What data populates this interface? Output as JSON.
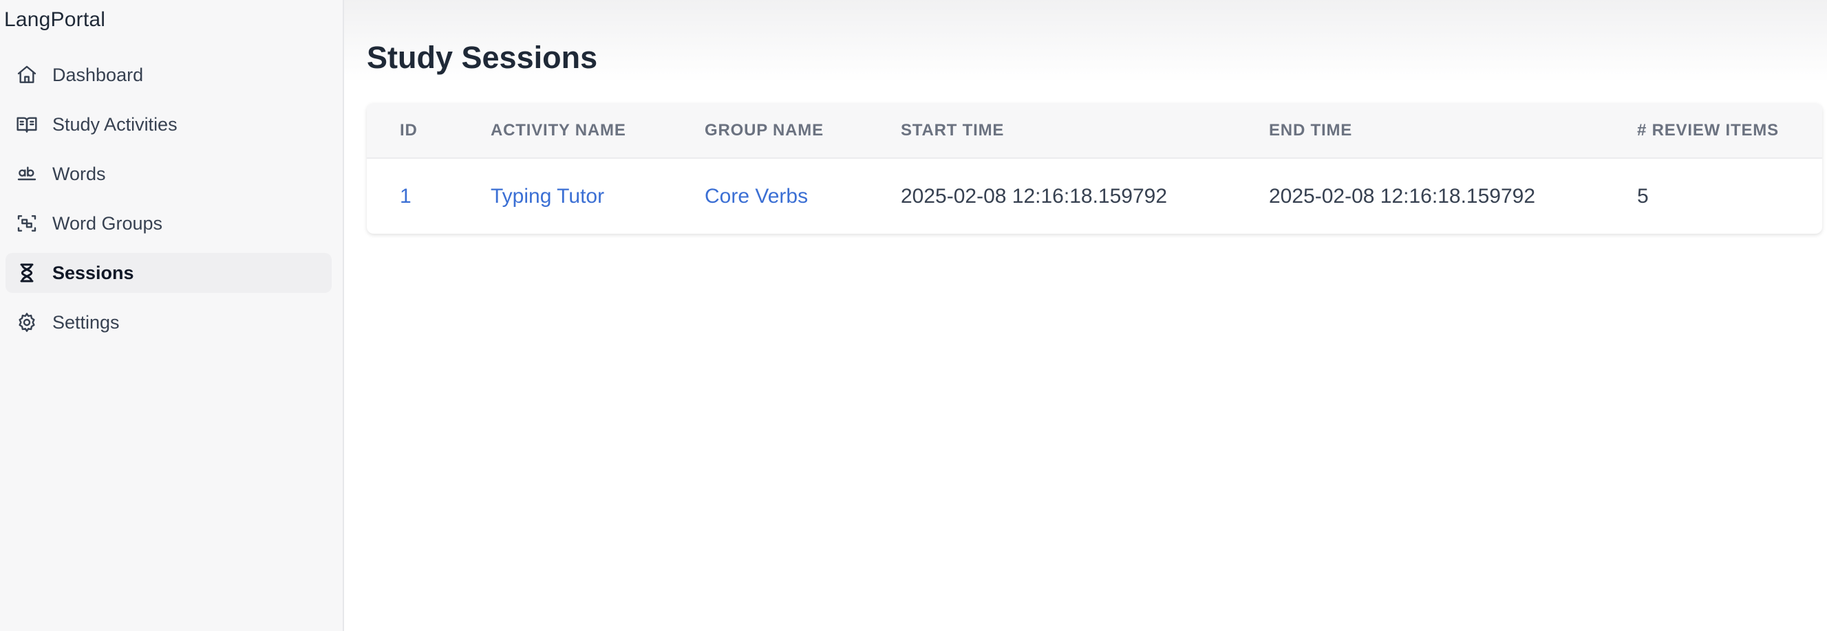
{
  "app": {
    "brand": "LangPortal"
  },
  "sidebar": {
    "items": [
      {
        "label": "Dashboard",
        "icon": "home-icon",
        "active": false
      },
      {
        "label": "Study Activities",
        "icon": "book-open-icon",
        "active": false
      },
      {
        "label": "Words",
        "icon": "whole-word-icon",
        "active": false
      },
      {
        "label": "Word Groups",
        "icon": "word-groups-icon",
        "active": false
      },
      {
        "label": "Sessions",
        "icon": "hourglass-icon",
        "active": true
      },
      {
        "label": "Settings",
        "icon": "gear-icon",
        "active": false
      }
    ]
  },
  "main": {
    "title": "Study Sessions",
    "table": {
      "headers": [
        "ID",
        "ACTIVITY NAME",
        "GROUP NAME",
        "START TIME",
        "END TIME",
        "# REVIEW ITEMS"
      ],
      "rows": [
        {
          "id": "1",
          "activity_name": "Typing Tutor",
          "group_name": "Core Verbs",
          "start_time": "2025-02-08 12:16:18.159792",
          "end_time": "2025-02-08 12:16:18.159792",
          "review_items": "5"
        }
      ]
    }
  },
  "colors": {
    "link": "#3b6fd4",
    "sidebar_bg": "#f7f7f8",
    "active_item_bg": "#efeff1"
  }
}
